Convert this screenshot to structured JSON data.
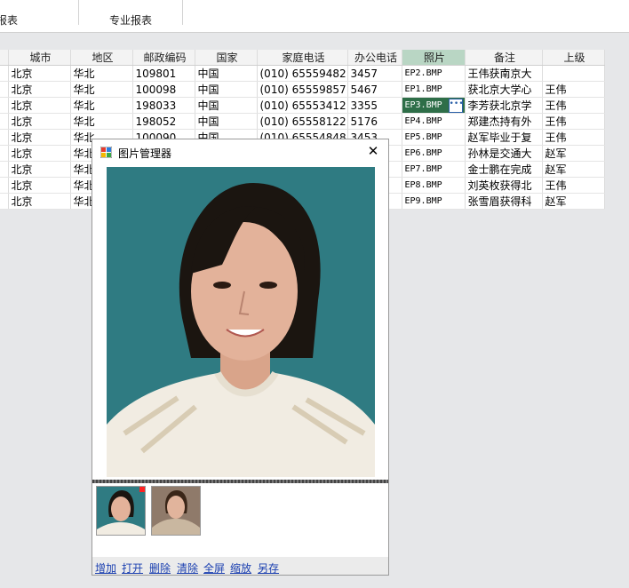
{
  "ribbon": {
    "group1_label": "报表",
    "group2_label": "专业报表"
  },
  "grid": {
    "headers": [
      "城市",
      "地区",
      "邮政编码",
      "国家",
      "家庭电话",
      "办公电话",
      "照片",
      "备注",
      "上级"
    ],
    "rows": [
      [
        "北京",
        "华北",
        "109801",
        "中国",
        "(010) 65559482",
        "3457",
        "EP2.BMP",
        "王伟获南京大",
        ""
      ],
      [
        "北京",
        "华北",
        "100098",
        "中国",
        "(010) 65559857",
        "5467",
        "EP1.BMP",
        "获北京大学心",
        "王伟"
      ],
      [
        "北京",
        "华北",
        "198033",
        "中国",
        "(010) 65553412",
        "3355",
        "EP3.BMP",
        "李芳获北京学",
        "王伟"
      ],
      [
        "北京",
        "华北",
        "198052",
        "中国",
        "(010) 65558122",
        "5176",
        "EP4.BMP",
        "郑建杰持有外",
        "王伟"
      ],
      [
        "北京",
        "华北",
        "100090",
        "中国",
        "(010) 65554848",
        "3453",
        "EP5.BMP",
        "赵军毕业于复",
        "王伟"
      ],
      [
        "北京",
        "华北",
        "",
        "",
        "",
        "",
        "EP6.BMP",
        "孙林是交通大",
        "赵军"
      ],
      [
        "北京",
        "华北",
        "",
        "",
        "",
        "",
        "EP7.BMP",
        "金士鹏在完成",
        "赵军"
      ],
      [
        "北京",
        "华北",
        "",
        "",
        "",
        "",
        "EP8.BMP",
        "刘英枚获得北",
        "王伟"
      ],
      [
        "北京",
        "华北",
        "",
        "",
        "",
        "",
        "EP9.BMP",
        "张雪眉获得科",
        "赵军"
      ]
    ]
  },
  "dialog": {
    "title": "图片管理器",
    "links": [
      "增加",
      "打开",
      "删除",
      "清除",
      "全屏",
      "缩放",
      "另存"
    ]
  },
  "colors": {
    "selected_cell": "#2e6e48",
    "selected_header": "#b9d6c4",
    "photo_background": "#2f7b82",
    "link": "#1a3fb0"
  }
}
